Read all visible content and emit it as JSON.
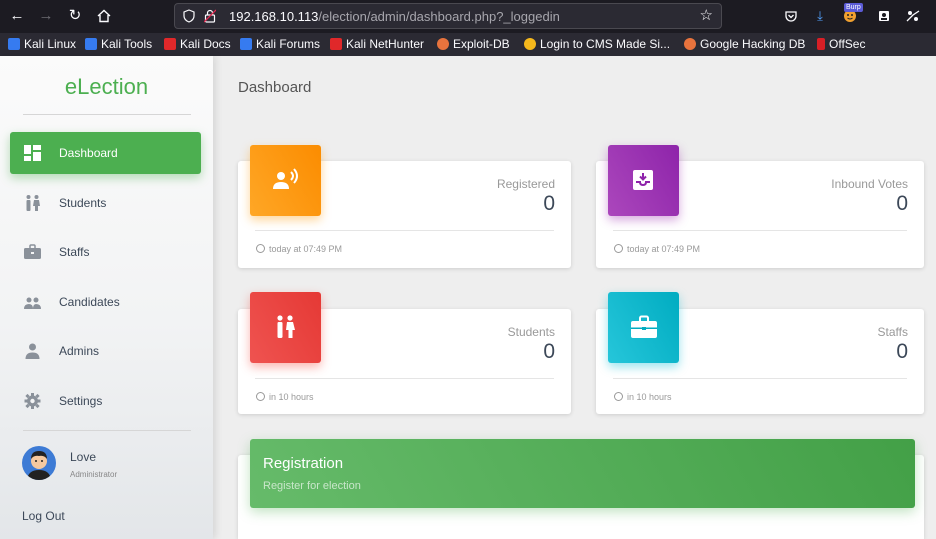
{
  "browser": {
    "url_host": "192.168.10.113",
    "url_path": "/election/admin/dashboard.php?_loggedin",
    "burp_badge": "Burp",
    "bookmarks": [
      {
        "label": "Kali Linux",
        "color": "#367bf0"
      },
      {
        "label": "Kali Tools",
        "color": "#367bf0"
      },
      {
        "label": "Kali Docs",
        "color": "#e0282a"
      },
      {
        "label": "Kali Forums",
        "color": "#367bf0"
      },
      {
        "label": "Kali NetHunter",
        "color": "#e0282a"
      },
      {
        "label": "Exploit-DB",
        "color": "#e8733d"
      },
      {
        "label": "Login to CMS Made Si...",
        "color": "#f5b81c"
      },
      {
        "label": "Google Hacking DB",
        "color": "#e8733d"
      },
      {
        "label": "OffSec",
        "color": "#d81f26"
      }
    ]
  },
  "sidebar": {
    "brand": "eLection",
    "items": [
      {
        "label": "Dashboard",
        "icon": "dashboard-icon",
        "active": true
      },
      {
        "label": "Students",
        "icon": "students-icon"
      },
      {
        "label": "Staffs",
        "icon": "briefcase-icon"
      },
      {
        "label": "Candidates",
        "icon": "group-icon"
      },
      {
        "label": "Admins",
        "icon": "person-icon"
      },
      {
        "label": "Settings",
        "icon": "gear-icon"
      }
    ],
    "user": {
      "name": "Love",
      "role": "Administrator"
    },
    "logout": "Log Out"
  },
  "main": {
    "title": "Dashboard",
    "cards": [
      {
        "category": "Registered",
        "value": "0",
        "footer": "today at 07:49 PM",
        "color": "#fb8c00",
        "icon": "record-voice-icon"
      },
      {
        "category": "Inbound Votes",
        "value": "0",
        "footer": "today at 07:49 PM",
        "color": "#8e24aa",
        "icon": "inbox-icon"
      },
      {
        "category": "Students",
        "value": "0",
        "footer": "in 10 hours",
        "color": "#e53935",
        "icon": "students-icon"
      },
      {
        "category": "Staffs",
        "value": "0",
        "footer": "in 10 hours",
        "color": "#00acc1",
        "icon": "briefcase-icon"
      }
    ],
    "registration": {
      "title": "Registration",
      "subtitle": "Register for election"
    }
  },
  "colors": {
    "accent": "#4caf50"
  }
}
